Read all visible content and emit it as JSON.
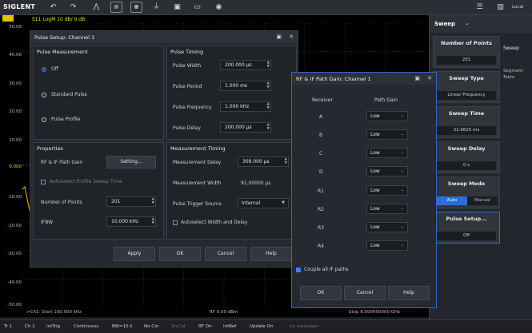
{
  "app": {
    "logo": "SIGLENT",
    "local": "Local"
  },
  "toolbar_icons": [
    "undo-icon",
    "redo-icon",
    "marker-icon",
    "channel-icon",
    "measure-icon",
    "power-icon",
    "save-icon",
    "open-icon",
    "camera-icon"
  ],
  "plot": {
    "trace_label": "S11 LogM 10 dB/ 0 dB",
    "y_ticks": [
      "50.00",
      "40.00",
      "30.00",
      "20.00",
      "10.00",
      "0.000",
      "-10.00",
      "-20.00",
      "-30.00",
      "-40.00",
      "-50.00"
    ],
    "start": ">Ch1: Start 100.000 kHz",
    "rf": "RF 0.00 dBm",
    "stop": "Stop 8.500000000 GHz"
  },
  "status_bar": [
    "Tr 1",
    "Ch 1",
    "IntTrig",
    "Continuous",
    "BW=10 k",
    "No Cor",
    "SrcCal",
    "RF On",
    "IntRef",
    "Update On",
    "no messages"
  ],
  "right_panel": {
    "title": "Sweep",
    "side_tab": "Sweep",
    "side_tab2": "Segment Table",
    "number_of_points": {
      "label": "Number of Points",
      "value": "201"
    },
    "sweep_type": {
      "label": "Sweep Type",
      "value": "Linear Frequency"
    },
    "sweep_time": {
      "label": "Sweep Time",
      "value": "32.6625 ms"
    },
    "sweep_delay": {
      "label": "Sweep Delay",
      "value": "0 s"
    },
    "sweep_mode": {
      "label": "Sweep Mode",
      "auto": "Auto",
      "manual": "Manual"
    },
    "pulse_setup": {
      "label": "Pulse Setup...",
      "value": "Off"
    }
  },
  "pulse_dialog": {
    "title": "Pulse Setup: Channel 1",
    "measurement": {
      "heading": "Pulse Measurement",
      "options": [
        "Off",
        "Standard Pulse",
        "Pulse Profile"
      ]
    },
    "timing": {
      "heading": "Pulse Timing",
      "width": {
        "label": "Pulse Width",
        "value": "200.000 µs"
      },
      "period": {
        "label": "Pulse Period",
        "value": "1.000 ms"
      },
      "frequency": {
        "label": "Pulse Frequency",
        "value": "1.000 kHz"
      },
      "delay": {
        "label": "Pulse Delay",
        "value": "200.000 µs"
      }
    },
    "properties": {
      "heading": "Properties",
      "rf_if_label": "RF & IF Path Gain",
      "setting_button": "Setting...",
      "autoselect_profile": "Autoselect Profile Sweep Time",
      "points_label": "Number of Points",
      "points_value": "201",
      "ifbw_label": "IFBW",
      "ifbw_value": "10.000 kHz"
    },
    "meas_timing": {
      "heading": "Measurement Timing",
      "delay": {
        "label": "Measurement Delay",
        "value": "309.000 µs"
      },
      "width": {
        "label": "Measurement Width",
        "value": "91.00000 µs"
      },
      "trigger": {
        "label": "Pulse Trigger Source",
        "value": "Internal"
      },
      "autoselect": "Autoselect Width and Delay"
    },
    "buttons": {
      "apply": "Apply",
      "ok": "OK",
      "cancel": "Cancel",
      "help": "Help"
    }
  },
  "gain_dialog": {
    "title": "RF & IF Path Gain: Channel 1",
    "col_receiver": "Receiver",
    "col_gain": "Path Gain",
    "rows": [
      {
        "receiver": "A",
        "gain": "Low"
      },
      {
        "receiver": "B",
        "gain": "Low"
      },
      {
        "receiver": "C",
        "gain": "Low"
      },
      {
        "receiver": "D",
        "gain": "Low"
      },
      {
        "receiver": "R1",
        "gain": "Low"
      },
      {
        "receiver": "R2",
        "gain": "Low"
      },
      {
        "receiver": "R3",
        "gain": "Low"
      },
      {
        "receiver": "R4",
        "gain": "Low"
      }
    ],
    "couple_label": "Couple all IF paths",
    "buttons": {
      "ok": "OK",
      "cancel": "Cancel",
      "help": "Help"
    }
  }
}
